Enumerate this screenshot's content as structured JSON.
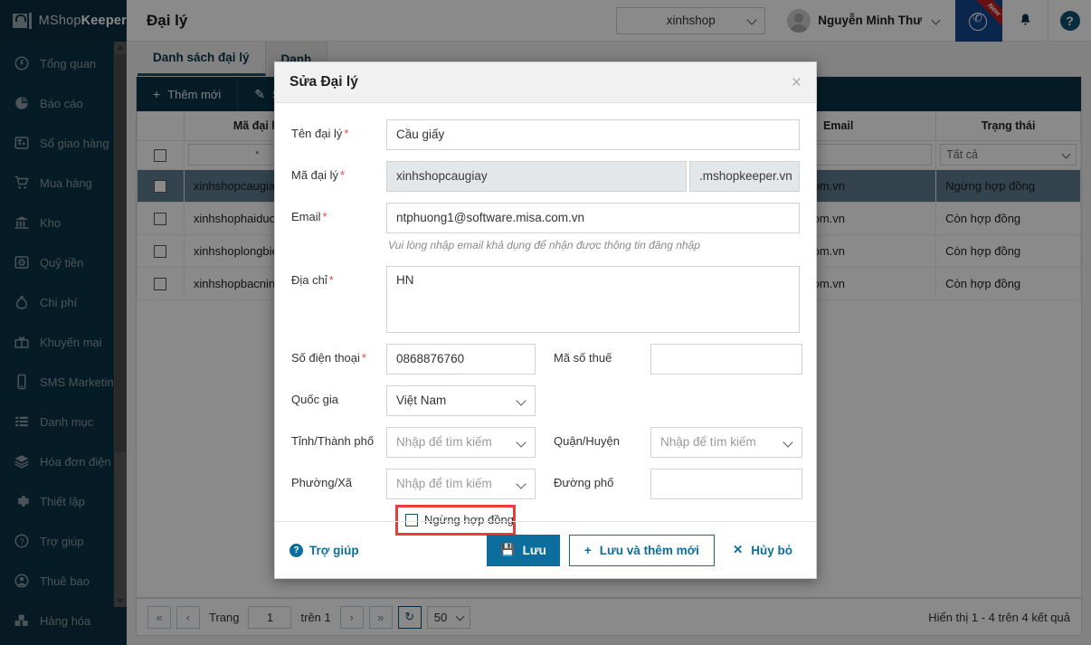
{
  "brand": {
    "prefix": "MShop",
    "suffix": "Keeper"
  },
  "sidebar": {
    "items": [
      {
        "label": "Tổng quan",
        "icon": "gauge-icon"
      },
      {
        "label": "Báo cáo",
        "icon": "pie-chart-icon"
      },
      {
        "label": "Sổ giao hàng",
        "icon": "delivery-book-icon"
      },
      {
        "label": "Mua hàng",
        "icon": "cart-icon"
      },
      {
        "label": "Kho",
        "icon": "bank-icon"
      },
      {
        "label": "Quỹ tiền",
        "icon": "safe-icon"
      },
      {
        "label": "Chi phí",
        "icon": "money-bag-icon"
      },
      {
        "label": "Khuyến mại",
        "icon": "gift-icon"
      },
      {
        "label": "SMS Marketing",
        "icon": "phone-icon"
      },
      {
        "label": "Danh mục",
        "icon": "list-icon"
      },
      {
        "label": "Hóa đơn điện tử",
        "icon": "layers-icon"
      },
      {
        "label": "Thiết lập",
        "icon": "gear-icon"
      },
      {
        "label": "Trợ giúp",
        "icon": "question-icon"
      },
      {
        "label": "Thuê bao",
        "icon": "user-icon"
      },
      {
        "label": "Hàng hóa",
        "icon": "boxes-icon"
      }
    ]
  },
  "header": {
    "page_title": "Đại lý",
    "shop_selected": "xinhshop",
    "user_name": "Nguyễn Minh Thư",
    "hotline_badge": "New",
    "icons": {
      "phone": "hotline-phone-icon",
      "bell": "bell-icon",
      "help": "?"
    }
  },
  "tabs": [
    {
      "label": "Danh sách đại lý",
      "active": true
    },
    {
      "label": "Danh",
      "active": false
    }
  ],
  "toolbar": [
    {
      "label": "Thêm mới",
      "icon": "+"
    },
    {
      "label": "Sửa",
      "icon": "✎"
    }
  ],
  "grid": {
    "columns": [
      "",
      "Mã đại lý",
      "Email",
      "Trạng thái"
    ],
    "filters": {
      "code": "*",
      "name": "",
      "email": "",
      "status": "Tất cả"
    },
    "rows": [
      {
        "code": "xinhshopcaugiay",
        "email": "ware.misa.com.vn",
        "status": "Ngừng hợp đồng",
        "selected": true
      },
      {
        "code": "xinhshophaiduon",
        "email": "ware.misa.com.vn",
        "status": "Còn hợp đồng",
        "selected": false
      },
      {
        "code": "xinhshoplongbie",
        "email": "ware.misa.com.vn",
        "status": "Còn hợp đồng",
        "selected": false
      },
      {
        "code": "xinhshopbacninh",
        "email": "ware.misa.com.vn",
        "status": "Còn hợp đồng",
        "selected": false
      }
    ]
  },
  "pager": {
    "first": "«",
    "prev": "‹",
    "next": "›",
    "last": "»",
    "refresh": "↻",
    "page_word": "Trang",
    "page_value": "1",
    "of_text": "trên 1",
    "page_size": "50",
    "result_text": "Hiển thị 1 - 4 trên 4 kết quả"
  },
  "modal": {
    "title": "Sửa Đại lý",
    "close": "×",
    "fields": {
      "name_label": "Tên đại lý",
      "name_value": "Cầu giấy",
      "code_label": "Mã đại lý",
      "code_value": "xinhshopcaugiay",
      "code_suffix": ".mshopkeeper.vn",
      "email_label": "Email",
      "email_value": "ntphuong1@software.misa.com.vn",
      "email_hint": "Vui lòng nhập email khả dụng để nhận được thông tin đăng nhập",
      "address_label": "Địa chỉ",
      "address_value": "HN",
      "phone_label": "Số điện thoại",
      "phone_value": "0868876760",
      "tax_label": "Mã số thuế",
      "tax_value": "",
      "country_label": "Quốc gia",
      "country_value": "Việt Nam",
      "province_label": "Tỉnh/Thành phố",
      "province_placeholder": "Nhập để tìm kiếm",
      "district_label": "Quận/Huyện",
      "district_placeholder": "Nhập để tìm kiếm",
      "ward_label": "Phường/Xã",
      "ward_placeholder": "Nhập để tìm kiếm",
      "street_label": "Đường phố",
      "street_value": "",
      "stop_contract_label": "Ngừng hợp đồng"
    },
    "footer": {
      "help": "Trợ giúp",
      "save": "Lưu",
      "save_add": "Lưu và thêm mới",
      "cancel": "Hủy bỏ"
    }
  },
  "colors": {
    "sidebar_bg": "#0a3547",
    "brand_bg": "#0c2e3d",
    "accent": "#0d6e9e",
    "toolbar_bg": "#0a3547",
    "highlight_red": "#ef3b36",
    "row_selected": "#5f7f91",
    "required_star": "#e8464a"
  }
}
